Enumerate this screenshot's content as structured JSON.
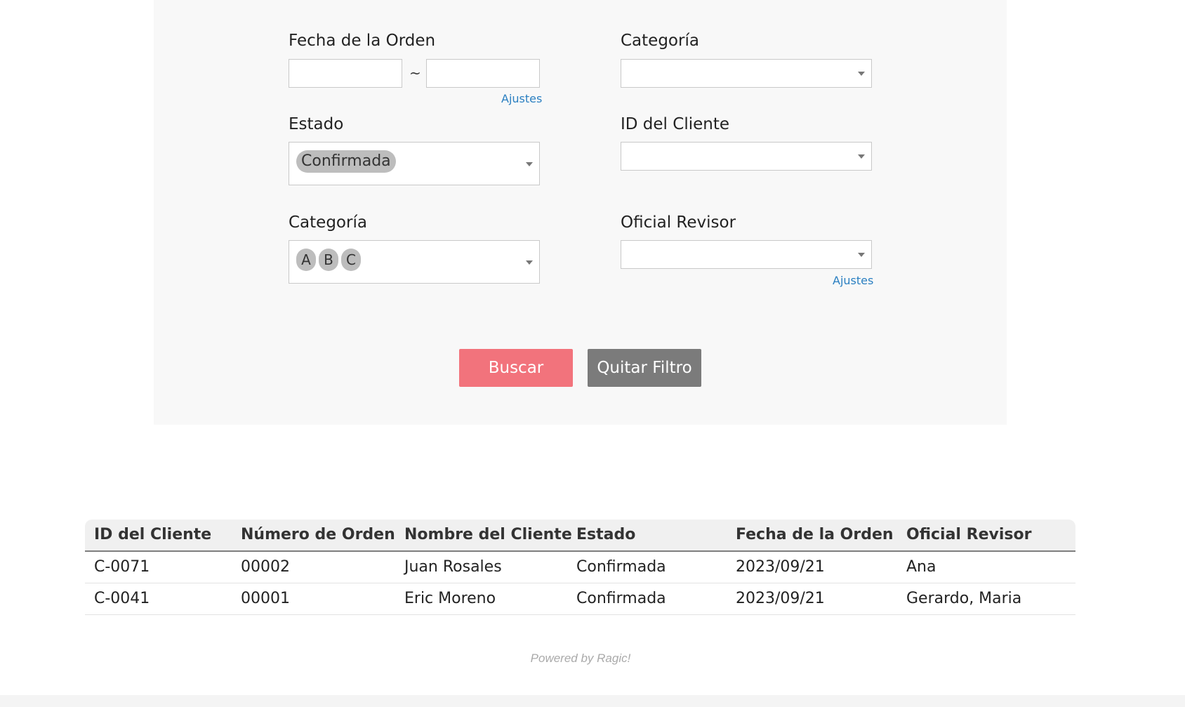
{
  "filters": {
    "order_date_label": "Fecha de la Orden",
    "order_date_separator": "~",
    "order_date_from": "",
    "order_date_to": "",
    "order_date_settings": "Ajustes",
    "category_label_top": "Categoría",
    "category_top_value": "",
    "status_label": "Estado",
    "status_selected": "Confirmada",
    "customer_id_label": "ID del Cliente",
    "customer_id_value": "",
    "category_label": "Categoría",
    "category_selected": [
      "A",
      "B",
      "C"
    ],
    "reviewer_label": "Oficial Revisor",
    "reviewer_value": "",
    "reviewer_settings": "Ajustes"
  },
  "buttons": {
    "search": "Buscar",
    "clear": "Quitar Filtro"
  },
  "table": {
    "headers": [
      "ID del Cliente",
      "Número de Orden",
      "Nombre del Cliente",
      "Estado",
      "Fecha de la Orden",
      "Oficial Revisor"
    ],
    "rows": [
      [
        "C-0071",
        "00002",
        "Juan Rosales",
        "Confirmada",
        "2023/09/21",
        "Ana"
      ],
      [
        "C-0041",
        "00001",
        "Eric Moreno",
        "Confirmada",
        "2023/09/21",
        "Gerardo, Maria"
      ]
    ]
  },
  "footer": {
    "powered_by": "Powered by Ragic!"
  }
}
